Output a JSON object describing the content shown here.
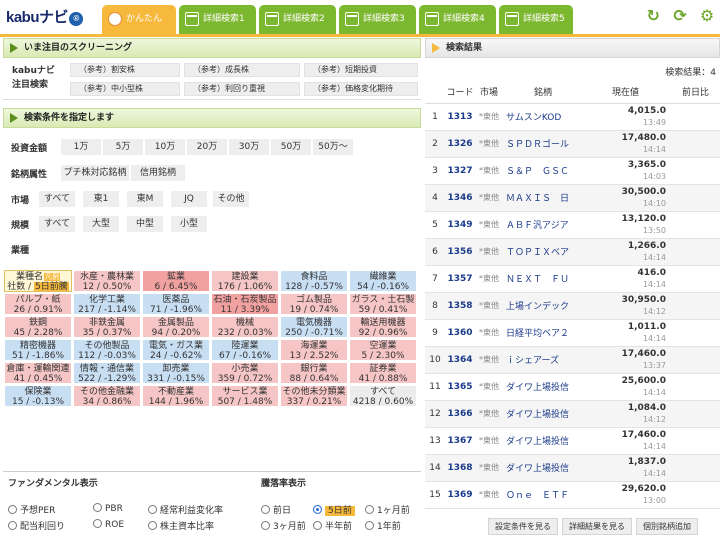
{
  "app": {
    "logo_text": "kabu",
    "logo_text2": "ナビ",
    "logo_mark": "®"
  },
  "tabs": [
    {
      "label": "かんたん",
      "active": true
    },
    {
      "label": "詳細検索1"
    },
    {
      "label": "詳細検索2"
    },
    {
      "label": "詳細検索3"
    },
    {
      "label": "詳細検索4"
    },
    {
      "label": "詳細検索5"
    }
  ],
  "header_icons": [
    "refresh-icon",
    "sync-icon",
    "settings-icon"
  ],
  "left": {
    "screening_title": "いま注目のスクリーニング",
    "screening_label1": "kabuナビ",
    "screening_label2": "注目検索",
    "screening_buttons": [
      "（参考）割安株",
      "（参考）成長株",
      "（参考）短期投資",
      "（参考）中小型株",
      "（参考）利回り重視",
      "（参考）価格変化期待"
    ],
    "conditions_title": "検索条件を指定します",
    "invest_label": "投資金額",
    "invest_opts": [
      "1万",
      "5万",
      "10万",
      "20万",
      "30万",
      "50万",
      "50万～"
    ],
    "attr_label": "銘柄属性",
    "attr_opts": [
      "プチ株対応銘柄",
      "信用銘柄"
    ],
    "market_label": "市場",
    "market_opts": [
      "すべて",
      "東1",
      "東M",
      "JQ",
      "その他"
    ],
    "scale_label": "規模",
    "scale_opts": [
      "すべて",
      "大型",
      "中型",
      "小型"
    ],
    "industry_label": "業種",
    "industry_header": {
      "name": "業種名",
      "badge": "凡例",
      "count": "社数",
      "period": "5日前騰"
    },
    "industries": [
      {
        "n": "水産・農林業",
        "v": "12 / 0.50%",
        "c": "red"
      },
      {
        "n": "鉱業",
        "v": "6 / 6.45%",
        "c": "red2"
      },
      {
        "n": "建設業",
        "v": "176 / 1.06%",
        "c": "red"
      },
      {
        "n": "食料品",
        "v": "128 / -0.57%",
        "c": "blue"
      },
      {
        "n": "繊維業",
        "v": "54 / -0.16%",
        "c": "blue"
      },
      {
        "n": "パルプ・紙",
        "v": "26 / 0.91%",
        "c": "red"
      },
      {
        "n": "化学工業",
        "v": "217 / -1.14%",
        "c": "blue"
      },
      {
        "n": "医薬品",
        "v": "71 / -1.96%",
        "c": "blue"
      },
      {
        "n": "石油・石炭製品",
        "v": "11 / 3.39%",
        "c": "red2"
      },
      {
        "n": "ゴム製品",
        "v": "19 / 0.74%",
        "c": "red"
      },
      {
        "n": "ガラス・土石製",
        "v": "59 / 0.41%",
        "c": "red"
      },
      {
        "n": "鉄鋼",
        "v": "45 / 2.28%",
        "c": "red"
      },
      {
        "n": "非鉄金属",
        "v": "35 / 0.37%",
        "c": "red"
      },
      {
        "n": "金属製品",
        "v": "94 / 0.20%",
        "c": "red"
      },
      {
        "n": "機械",
        "v": "232 / 0.03%",
        "c": "red"
      },
      {
        "n": "電気機器",
        "v": "250 / -0.71%",
        "c": "blue"
      },
      {
        "n": "輸送用機器",
        "v": "92 / 0.96%",
        "c": "red"
      },
      {
        "n": "精密機器",
        "v": "51 / -1.86%",
        "c": "blue"
      },
      {
        "n": "その他製品",
        "v": "112 / -0.03%",
        "c": "blue"
      },
      {
        "n": "電気・ガス業",
        "v": "24 / -0.62%",
        "c": "blue"
      },
      {
        "n": "陸運業",
        "v": "67 / -0.16%",
        "c": "blue"
      },
      {
        "n": "海運業",
        "v": "13 / 2.52%",
        "c": "red"
      },
      {
        "n": "空運業",
        "v": "5 / 2.30%",
        "c": "red"
      },
      {
        "n": "倉庫・運輸関連",
        "v": "41 / 0.45%",
        "c": "red"
      },
      {
        "n": "情報・通信業",
        "v": "522 / -1.29%",
        "c": "blue"
      },
      {
        "n": "卸売業",
        "v": "331 / -0.15%",
        "c": "blue"
      },
      {
        "n": "小売業",
        "v": "359 / 0.72%",
        "c": "red"
      },
      {
        "n": "銀行業",
        "v": "88 / 0.64%",
        "c": "red"
      },
      {
        "n": "証券業",
        "v": "41 / 0.88%",
        "c": "red"
      },
      {
        "n": "保険業",
        "v": "15 / -0.13%",
        "c": "blue"
      },
      {
        "n": "その他金融業",
        "v": "34 / 0.86%",
        "c": "red"
      },
      {
        "n": "不動産業",
        "v": "144 / 1.96%",
        "c": "red"
      },
      {
        "n": "サービス業",
        "v": "507 / 1.48%",
        "c": "red"
      },
      {
        "n": "その他未分類業",
        "v": "337 / 0.21%",
        "c": "red"
      },
      {
        "n": "すべて",
        "v": "4218 / 0.60%",
        "c": "gray"
      }
    ],
    "fund_title": "ファンダメンタル表示",
    "fund_opts": [
      "予想PER",
      "PBR",
      "経常利益変化率",
      "配当利回り",
      "ROE",
      "株主資本比率"
    ],
    "rate_title": "騰落率表示",
    "rate_opts": [
      "前日",
      "5日前",
      "1ヶ月前",
      "3ヶ月前",
      "半年前",
      "1年前"
    ],
    "rate_selected": "5日前"
  },
  "right": {
    "title": "検索結果",
    "count_text": "検索結果：4",
    "columns": [
      "コード",
      "市場",
      "銘柄",
      "現在値",
      "前日比"
    ],
    "rows": [
      {
        "i": "1",
        "code": "1313",
        "mkt": "*東他",
        "name": "サムスンKOD",
        "price": "4,015.0",
        "time": "13:49"
      },
      {
        "i": "2",
        "code": "1326",
        "mkt": "*東他",
        "name": "ＳＰＤＲゴール",
        "price": "17,480.0",
        "time": "14:14"
      },
      {
        "i": "3",
        "code": "1327",
        "mkt": "*東他",
        "name": "Ｓ＆Ｐ　ＧＳＣ",
        "price": "3,365.0",
        "time": "14:03"
      },
      {
        "i": "4",
        "code": "1346",
        "mkt": "*東他",
        "name": "ＭＡＸＩＳ　日",
        "price": "30,500.0",
        "time": "14:10"
      },
      {
        "i": "5",
        "code": "1349",
        "mkt": "*東他",
        "name": "ＡＢＦ汎アジア",
        "price": "13,120.0",
        "time": "13:50"
      },
      {
        "i": "6",
        "code": "1356",
        "mkt": "*東他",
        "name": "ＴＯＰＩＸベア",
        "price": "1,266.0",
        "time": "14:14"
      },
      {
        "i": "7",
        "code": "1357",
        "mkt": "*東他",
        "name": "ＮＥＸＴ　ＦＵ",
        "price": "416.0",
        "time": "14:14"
      },
      {
        "i": "8",
        "code": "1358",
        "mkt": "*東他",
        "name": "上場インデック",
        "price": "30,950.0",
        "time": "14:12"
      },
      {
        "i": "9",
        "code": "1360",
        "mkt": "*東他",
        "name": "日経平均ベア２",
        "price": "1,011.0",
        "time": "14:14"
      },
      {
        "i": "10",
        "code": "1364",
        "mkt": "*東他",
        "name": "ｉシェアーズ",
        "price": "17,460.0",
        "time": "13:37"
      },
      {
        "i": "11",
        "code": "1365",
        "mkt": "*東他",
        "name": "ダイワ上場投信",
        "price": "25,600.0",
        "time": "14:14"
      },
      {
        "i": "12",
        "code": "1366",
        "mkt": "*東他",
        "name": "ダイワ上場投信",
        "price": "1,084.0",
        "time": "14:12"
      },
      {
        "i": "13",
        "code": "1367",
        "mkt": "*東他",
        "name": "ダイワ上場投信",
        "price": "17,460.0",
        "time": "14:14"
      },
      {
        "i": "14",
        "code": "1368",
        "mkt": "*東他",
        "name": "ダイワ上場投信",
        "price": "1,837.0",
        "time": "14:14"
      },
      {
        "i": "15",
        "code": "1369",
        "mkt": "*東他",
        "name": "Ｏｎｅ　ＥＴＦ",
        "price": "29,620.0",
        "time": "13:00"
      }
    ],
    "buttons": [
      "設定条件を見る",
      "詳細結果を見る",
      "個別銘柄追加"
    ]
  }
}
